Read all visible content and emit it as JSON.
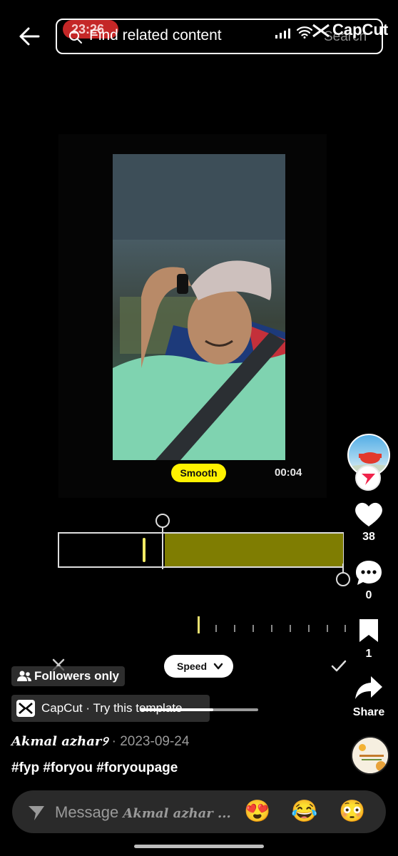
{
  "status": {
    "time": "23:26"
  },
  "watermark": {
    "brand": "CapCut"
  },
  "search": {
    "placeholder": "Find related content",
    "button_label": "Search"
  },
  "video": {
    "speed_mode": "Smooth",
    "duration": "00:04"
  },
  "editor": {
    "speed_label": "Speed",
    "trim_fill_fraction": 0.63
  },
  "rail": {
    "likes": "38",
    "comments": "0",
    "saves": "1",
    "share_label": "Share"
  },
  "post": {
    "visibility": "Followers only",
    "template_link": "CapCut · Try this template",
    "author": "Akmal azhar",
    "author_badge": "୨",
    "date_sep": " · ",
    "date": "2023-09-24",
    "hashtags": "#fyp #foryou #foryoupage",
    "playback_progress": 0.62
  },
  "message": {
    "placeholder": "Message ",
    "placeholder_name": "Akmal azhar ...",
    "emojis": [
      "😍",
      "😂",
      "😳"
    ]
  },
  "colors": {
    "accent": "#fff200",
    "trim_fill": "#7f7d02",
    "record_pill": "#d92b2b"
  }
}
